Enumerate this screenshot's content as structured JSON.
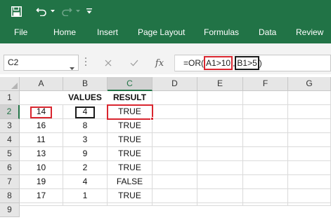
{
  "ribbon": {
    "tabs": [
      "File",
      "Home",
      "Insert",
      "Page Layout",
      "Formulas",
      "Data",
      "Review"
    ]
  },
  "formula_bar": {
    "name_box": "C2",
    "fx_label": "fx",
    "formula_prefix": "=OR(",
    "formula_arg1": "A1>10",
    "formula_sep": ",",
    "formula_arg2": "B1>5",
    "formula_suffix": ")"
  },
  "sheet": {
    "columns": [
      "A",
      "B",
      "C",
      "D",
      "E",
      "F",
      "G"
    ],
    "rows": [
      "1",
      "2",
      "3",
      "4",
      "5",
      "6",
      "7",
      "8",
      "9"
    ],
    "selected_cell": "C2",
    "cells": {
      "B1": "VALUES",
      "C1": "RESULT",
      "A2": "14",
      "B2": "4",
      "C2": "TRUE",
      "A3": "16",
      "B3": "8",
      "C3": "TRUE",
      "A4": "11",
      "B4": "3",
      "C4": "TRUE",
      "A5": "13",
      "B5": "9",
      "C5": "TRUE",
      "A6": "10",
      "B6": "2",
      "C6": "TRUE",
      "A7": "19",
      "B7": "4",
      "C7": "FALSE",
      "A8": "17",
      "B8": "1",
      "C8": "TRUE"
    }
  },
  "colors": {
    "excel_green": "#217346",
    "highlight_red": "#d9262f",
    "highlight_black": "#1a1a1a"
  }
}
